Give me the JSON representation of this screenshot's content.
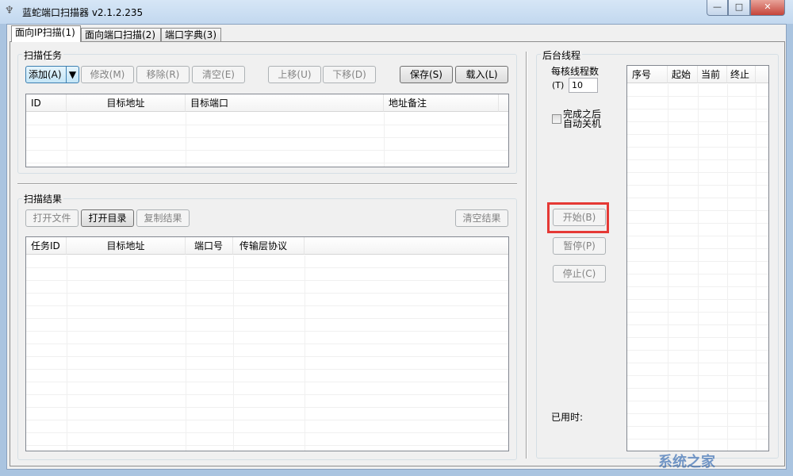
{
  "window": {
    "title": "蓝蛇端口扫描器 v2.1.2.235",
    "app_icon": "snake-app-icon",
    "controls": {
      "minimize": "—",
      "maximize": "□",
      "close": "✕"
    }
  },
  "tabs": [
    {
      "label": "面向IP扫描(1)",
      "active": true
    },
    {
      "label": "面向端口扫描(2)",
      "active": false
    },
    {
      "label": "端口字典(3)",
      "active": false
    }
  ],
  "task_group": {
    "title": "扫描任务",
    "buttons": {
      "add": "添加(A)",
      "edit": "修改(M)",
      "remove": "移除(R)",
      "clear": "清空(E)",
      "up": "上移(U)",
      "down": "下移(D)",
      "save": "保存(S)",
      "load": "载入(L)"
    },
    "columns": [
      "ID",
      "目标地址",
      "目标端口",
      "地址备注"
    ]
  },
  "result_group": {
    "title": "扫描结果",
    "buttons": {
      "open_file": "打开文件",
      "open_dir": "打开目录",
      "copy": "复制结果",
      "clear": "清空结果"
    },
    "columns": [
      "任务ID",
      "目标地址",
      "端口号",
      "传输层协议"
    ]
  },
  "thread_group": {
    "title": "后台线程",
    "threads_label": "每核线程数",
    "threads_key": "(T)",
    "threads_value": "10",
    "shutdown_label_1": "完成之后",
    "shutdown_label_2": "自动关机",
    "shutdown_checked": false,
    "start": "开始(B)",
    "pause": "暂停(P)",
    "stop": "停止(C)",
    "elapsed_label": "已用时:",
    "columns": [
      "序号",
      "起始",
      "当前",
      "终止"
    ]
  },
  "highlight_color": "#e53935",
  "watermark": "系统之家"
}
